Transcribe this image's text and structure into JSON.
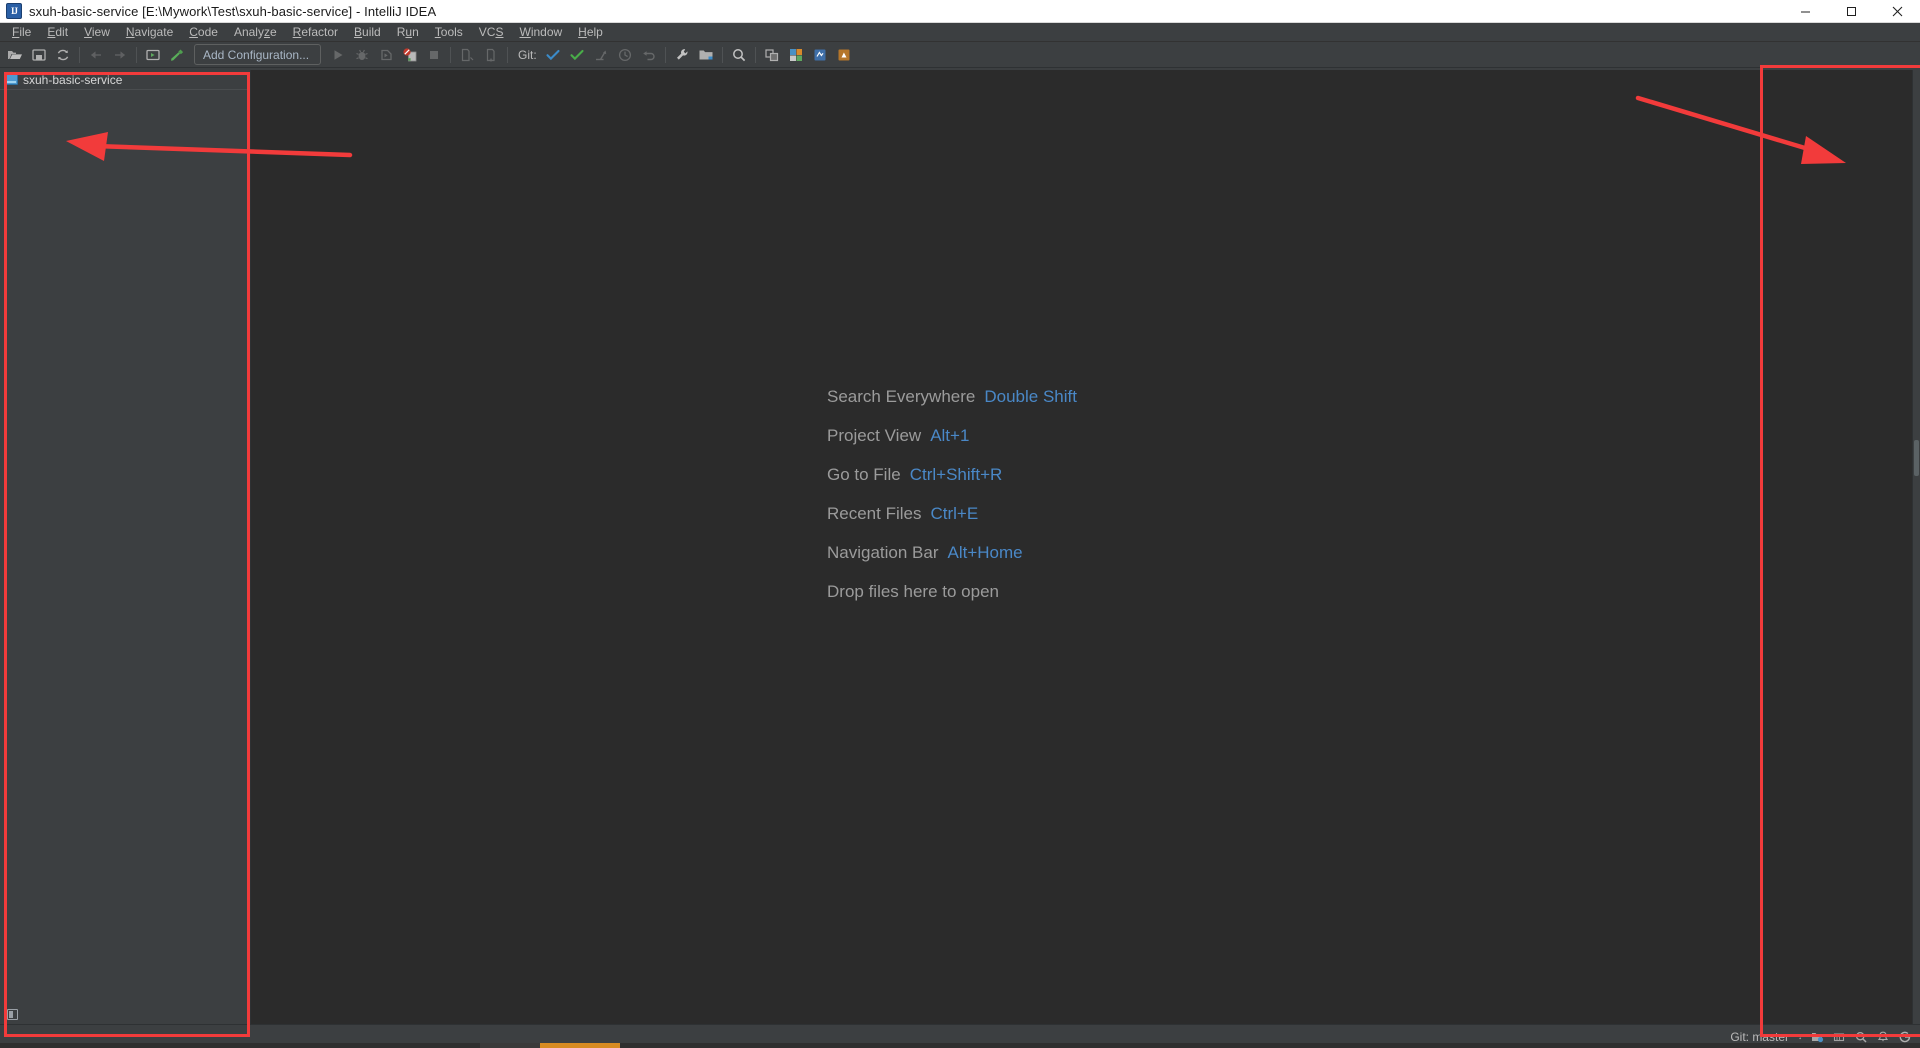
{
  "window": {
    "title": "sxuh-basic-service [E:\\Mywork\\Test\\sxuh-basic-service] - IntelliJ IDEA",
    "app_icon_text": "IJ",
    "controls": {
      "minimize": "minimize-button",
      "maximize": "maximize-button",
      "close": "close-button"
    }
  },
  "menubar": {
    "items": [
      {
        "label": "File",
        "mnemonic": "F"
      },
      {
        "label": "Edit",
        "mnemonic": "E"
      },
      {
        "label": "View",
        "mnemonic": "V"
      },
      {
        "label": "Navigate",
        "mnemonic": "N"
      },
      {
        "label": "Code",
        "mnemonic": "C"
      },
      {
        "label": "Analyze",
        "mnemonic": "z"
      },
      {
        "label": "Refactor",
        "mnemonic": "R"
      },
      {
        "label": "Build",
        "mnemonic": "B"
      },
      {
        "label": "Run",
        "mnemonic": "u"
      },
      {
        "label": "Tools",
        "mnemonic": "T"
      },
      {
        "label": "VCS",
        "mnemonic": "S"
      },
      {
        "label": "Window",
        "mnemonic": "W"
      },
      {
        "label": "Help",
        "mnemonic": "H"
      }
    ]
  },
  "toolbar": {
    "open_icon": "open-folder-icon",
    "save_icon": "save-all-icon",
    "sync_icon": "synchronize-icon",
    "back_icon": "navigate-back-icon",
    "forward_icon": "navigate-forward-icon",
    "structure_icon": "project-structure-icon",
    "build_icon": "build-project-icon",
    "config_label": "Add Configuration...",
    "run_icon": "run-icon",
    "debug_icon": "debug-icon",
    "run_coverage_icon": "run-with-coverage-icon",
    "profiler_icon": "profiler-icon",
    "stop_icon": "stop-icon",
    "git_label": "Git:",
    "update_icon": "git-update-project-icon",
    "commit_icon": "git-commit-icon",
    "push_icon": "git-push-icon",
    "history_icon": "git-history-icon",
    "rollback_icon": "git-rollback-icon",
    "settings_icon": "settings-wrench-icon",
    "project_icon": "project-folder-icon",
    "search_icon": "search-everywhere-icon",
    "diff_icon": "compare-files-icon",
    "db_icon": "database-icon",
    "plugin_icon1": "plugin-icon-blue",
    "plugin_icon2": "plugin-icon-orange"
  },
  "project_pane": {
    "tab_label": "sxuh-basic-service",
    "tab_icon": "module-icon",
    "footer_icon": "tool-window-icon"
  },
  "editor": {
    "welcome_lines": [
      {
        "title": "Search Everywhere",
        "shortcut": "Double Shift"
      },
      {
        "title": "Project View",
        "shortcut": "Alt+1"
      },
      {
        "title": "Go to File",
        "shortcut": "Ctrl+Shift+R"
      },
      {
        "title": "Recent Files",
        "shortcut": "Ctrl+E"
      },
      {
        "title": "Navigation Bar",
        "shortcut": "Alt+Home"
      },
      {
        "title": "Drop files here to open",
        "shortcut": ""
      }
    ]
  },
  "statusbar": {
    "git_branch": "Git: master",
    "branch_caret": "↕",
    "icons": [
      "vcs-widget-icon",
      "memory-indicator-icon",
      "inspection-icon",
      "notifications-icon",
      "ide-help-icon"
    ]
  },
  "annotations": {
    "accent_color": "#f23b3b",
    "left_box": "project-pane-highlight-box",
    "right_box": "right-toolwindow-highlight-box",
    "left_arrow": "left-pointing-arrow",
    "right_arrow": "right-pointing-arrow"
  }
}
